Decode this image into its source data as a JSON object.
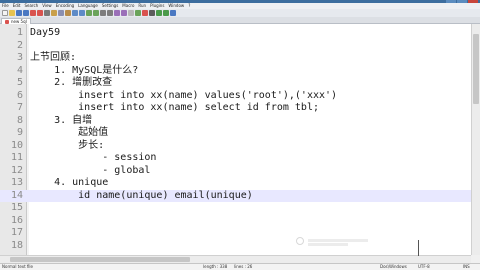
{
  "app": {
    "menu": [
      "File",
      "Edit",
      "Search",
      "View",
      "Encoding",
      "Language",
      "Settings",
      "Macro",
      "Run",
      "Plugins",
      "Window",
      "?"
    ],
    "tab_label": "new 5ql"
  },
  "editor": {
    "lines": [
      {
        "no": "1",
        "text": "Day59"
      },
      {
        "no": "2",
        "text": ""
      },
      {
        "no": "3",
        "text": "上节回顾:"
      },
      {
        "no": "4",
        "text": "    1. MySQL是什么?"
      },
      {
        "no": "5",
        "text": "    2. 增删改查"
      },
      {
        "no": "6",
        "text": "        insert into xx(name) values('root'),('xxx')"
      },
      {
        "no": "7",
        "text": "        insert into xx(name) select id from tbl;"
      },
      {
        "no": "8",
        "text": "    3. 自增"
      },
      {
        "no": "9",
        "text": "        起始值"
      },
      {
        "no": "10",
        "text": "        步长:"
      },
      {
        "no": "11",
        "text": "            - session"
      },
      {
        "no": "12",
        "text": "            - global"
      },
      {
        "no": "13",
        "text": "    4. unique"
      },
      {
        "no": "14",
        "text": "        id name(unique) email(unique)"
      },
      {
        "no": "15",
        "text": ""
      },
      {
        "no": "16",
        "text": ""
      },
      {
        "no": "17",
        "text": ""
      },
      {
        "no": "18",
        "text": ""
      }
    ],
    "current_line_index": 13
  },
  "statusbar": {
    "file_type": "Normal text file",
    "length": "length : 338",
    "lines": "lines : 26",
    "eol": "Dos\\Windows",
    "encoding": "UTF-8",
    "mode": "INS"
  },
  "colors": {
    "titlebar": "#3c6d9e",
    "current_line": "#e8e8ff",
    "gutter": "#e8e8e8"
  }
}
